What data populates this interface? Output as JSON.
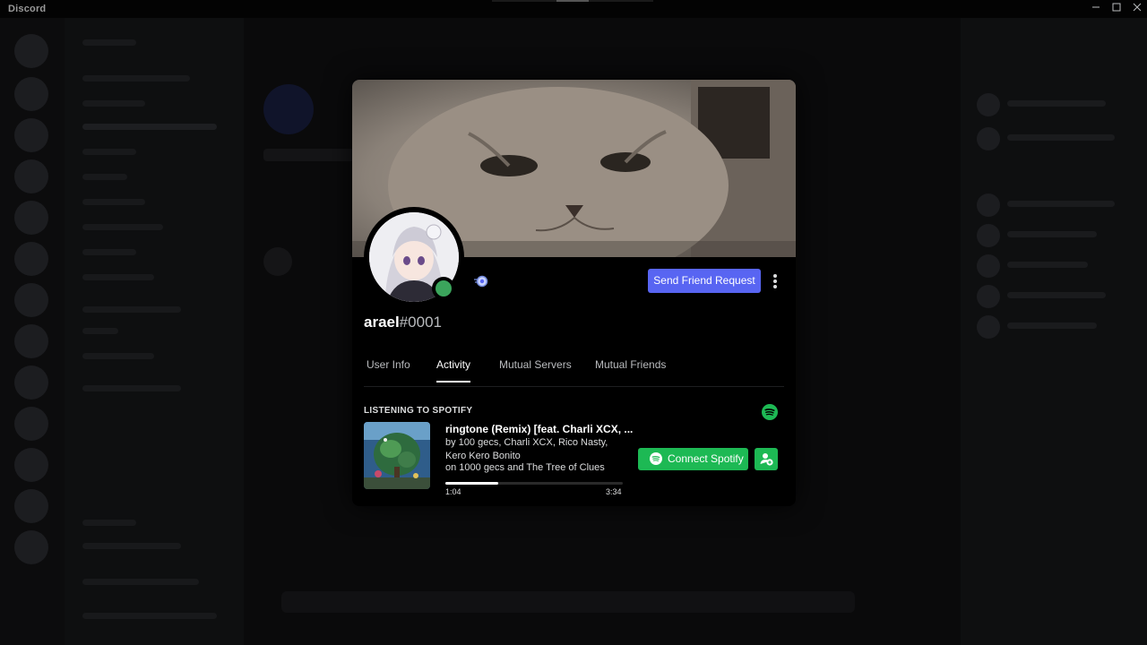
{
  "window": {
    "app_title": "Discord",
    "minimize_icon": "minimize-icon",
    "maximize_icon": "maximize-icon",
    "close_icon": "close-icon"
  },
  "profile": {
    "username": "arael",
    "discriminator": "#0001",
    "status": "online",
    "status_color": "#3ba55c",
    "send_friend_request_label": "Send Friend Request",
    "more_icon": "more-vertical-icon",
    "badge_icon": "badge-icon"
  },
  "tabs": [
    {
      "label": "User Info",
      "active": false
    },
    {
      "label": "Activity",
      "active": true
    },
    {
      "label": "Mutual Servers",
      "active": false
    },
    {
      "label": "Mutual Friends",
      "active": false
    }
  ],
  "activity": {
    "section_title": "LISTENING TO SPOTIFY",
    "track": "ringtone (Remix) [feat. Charli XCX, ...",
    "artist": "by 100 gecs, Charli XCX, Rico Nasty, Kero Kero Bonito",
    "album": "on 1000 gecs and The Tree of Clues",
    "elapsed": "1:04",
    "duration": "3:34",
    "progress_fraction": 0.299,
    "connect_label": "Connect Spotify",
    "spotify_color": "#1db954"
  },
  "colors": {
    "blurple": "#5865f2",
    "spotify": "#1db954",
    "online": "#3ba55c"
  }
}
